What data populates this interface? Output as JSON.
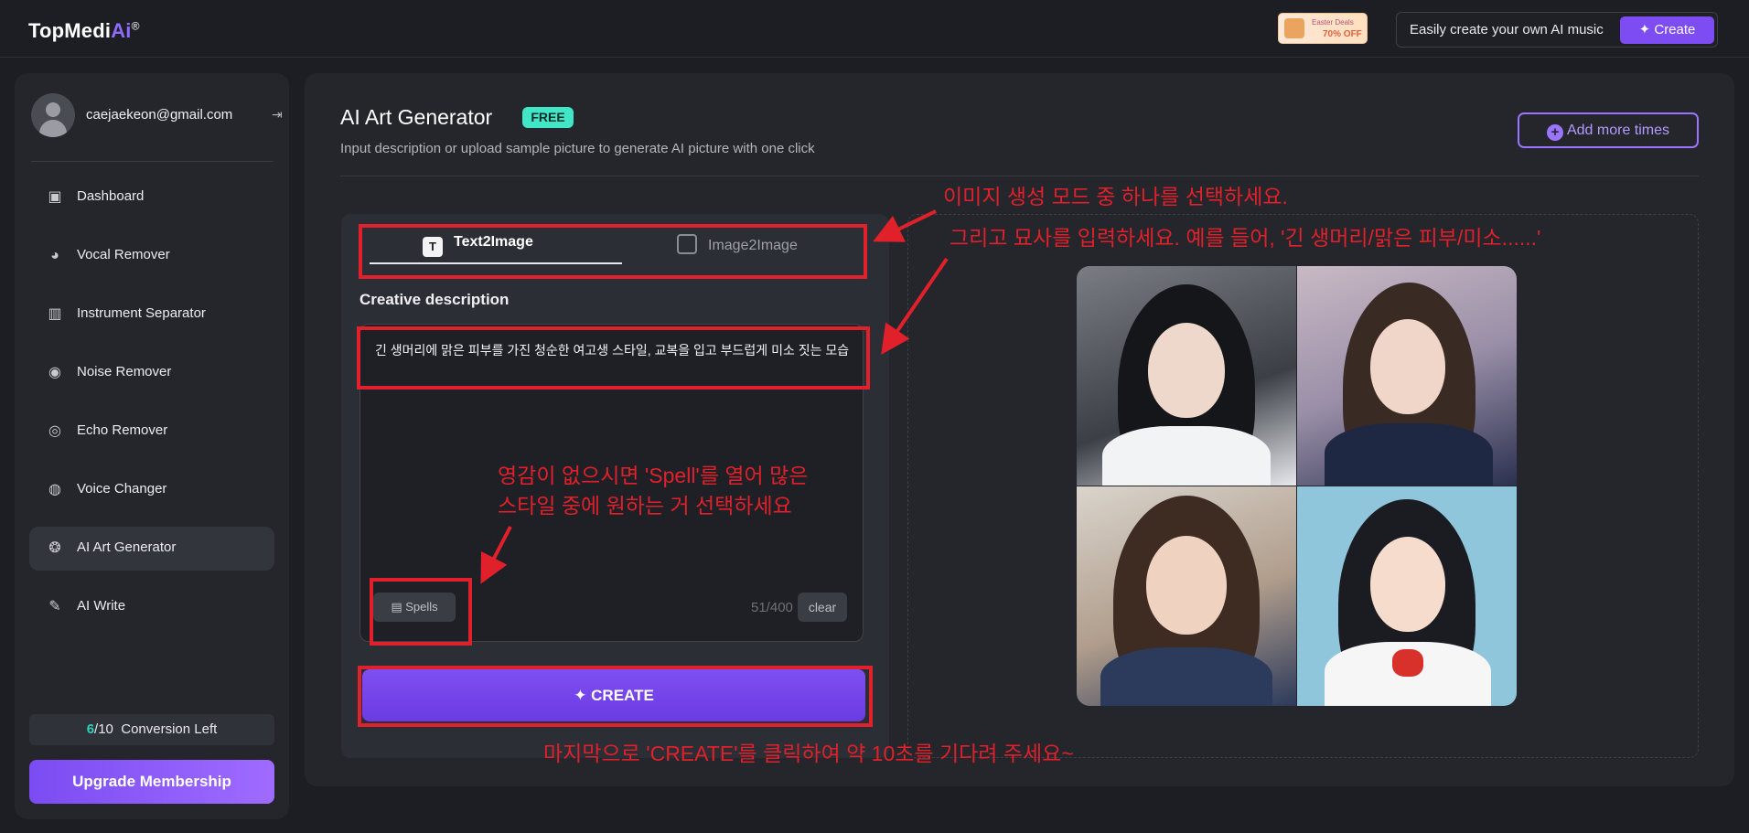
{
  "brand": {
    "logo_main": "TopMedi",
    "logo_ai": "Ai",
    "logo_reg": "®"
  },
  "promo": {
    "line1": "Easter Deals",
    "line2": "70% OFF"
  },
  "top_cta": {
    "text": "Easily create your own AI music",
    "button": "Create"
  },
  "user": {
    "email": "caejaekeon@gmail.com"
  },
  "sidebar": {
    "items": [
      {
        "label": "Dashboard",
        "icon": "briefcase-icon"
      },
      {
        "label": "Vocal Remover",
        "icon": "head-icon"
      },
      {
        "label": "Instrument Separator",
        "icon": "piano-icon"
      },
      {
        "label": "Noise Remover",
        "icon": "noise-icon"
      },
      {
        "label": "Echo Remover",
        "icon": "echo-icon"
      },
      {
        "label": "Voice Changer",
        "icon": "voice-icon"
      },
      {
        "label": "AI Art Generator",
        "icon": "palette-icon",
        "active": true
      },
      {
        "label": "AI Write",
        "icon": "write-icon"
      }
    ],
    "conversion_used": "6",
    "conversion_total": "/10",
    "conversion_text": "Conversion Left",
    "upgrade": "Upgrade Membership"
  },
  "main": {
    "title": "AI Art Generator",
    "badge": "FREE",
    "subtitle": "Input description or upload sample picture to generate AI picture with one click",
    "add_more": "Add more times",
    "tabs": [
      {
        "label": "Text2Image",
        "active": true
      },
      {
        "label": "Image2Image"
      }
    ],
    "desc_label": "Creative description",
    "desc_value": "긴 생머리에 맑은 피부를 가진 청순한 여고생 스타일, 교복을 입고 부드럽게 미소 짓는 모습",
    "spells": "Spells",
    "counter": "51/400",
    "clear": "clear",
    "create": "CREATE"
  },
  "annotations": {
    "note1": "이미지 생성 모드 중 하나를 선택하세요.",
    "note2": "그리고 묘사를 입력하세요. 예를 들어, '긴 생머리/맑은 피부/미소......'",
    "note3a": "영감이 없으시면 'Spell'를 열어 많은",
    "note3b": "스타일 중에 원하는 거 선택하세요",
    "note4": "마지막으로 'CREATE'를 클릭하여 약 10초를 기다려 주세요~",
    "color": "#e0202a"
  },
  "colors": {
    "accent": "#7d4cf3",
    "free_badge": "#41e6c7",
    "conversion_count": "#2fd2b9"
  }
}
